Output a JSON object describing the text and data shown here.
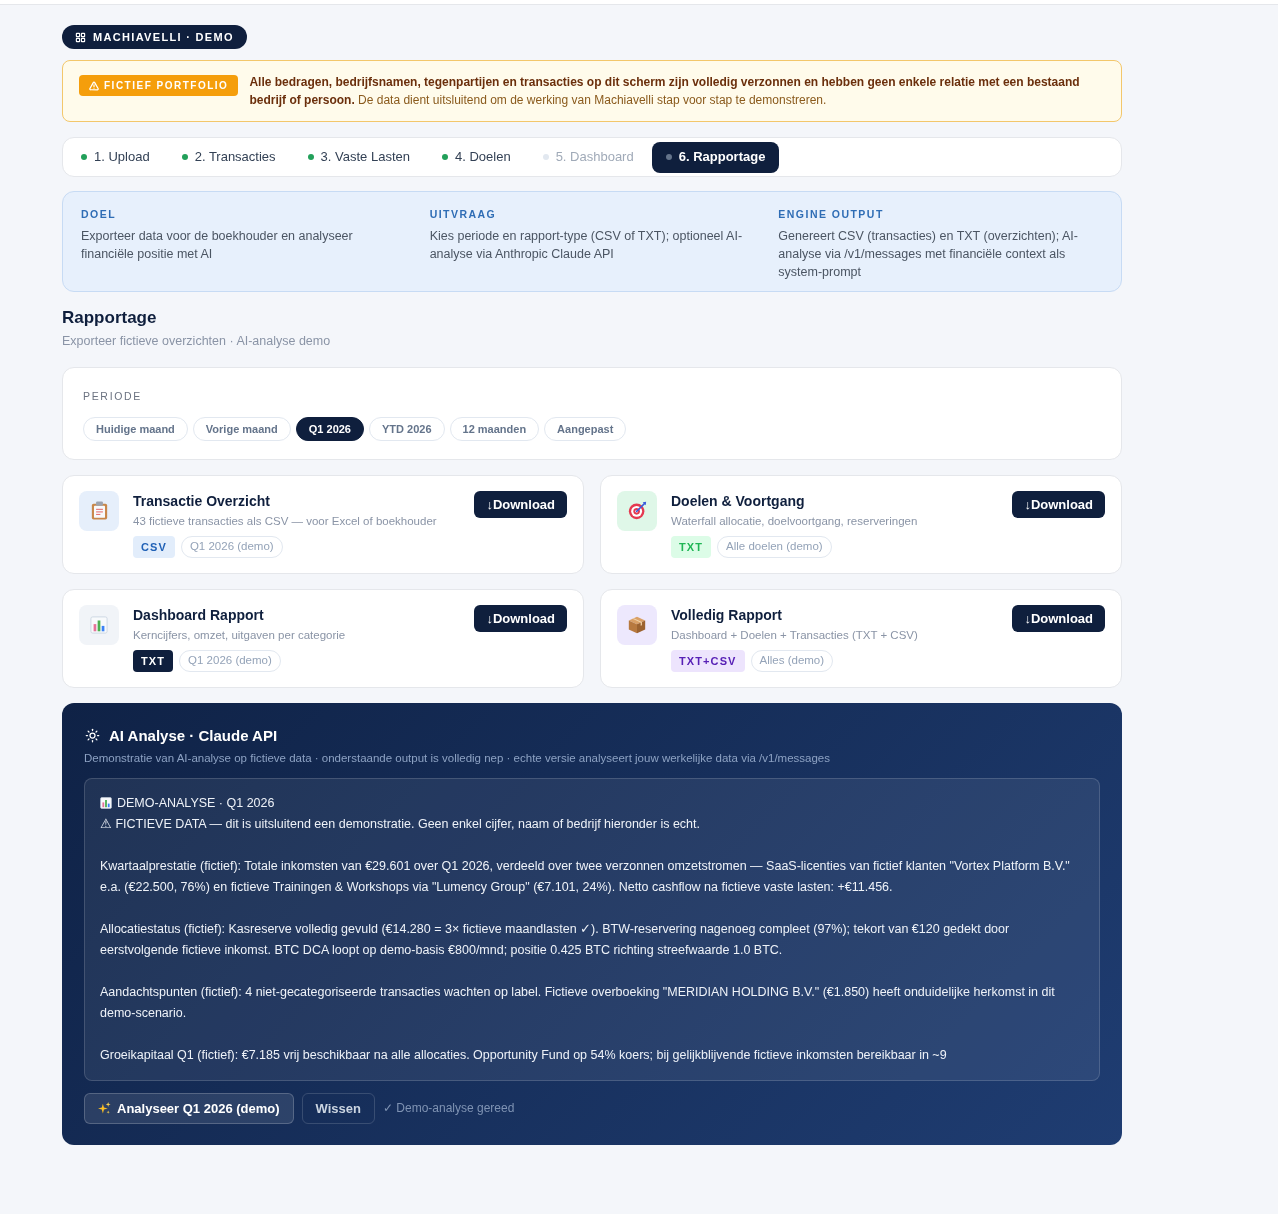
{
  "brand": {
    "label": "MACHIAVELLI · DEMO"
  },
  "notice": {
    "badge": "FICTIEF PORTFOLIO",
    "text": "**Alle bedragen, bedrijfsnamen, tegenpartijen en transacties op dit scherm zijn volledig verzonnen en hebben geen enkele relatie met een bestaand bedrijf of persoon.** De data dient uitsluitend om de werking van Machiavelli stap voor stap te demonstreren."
  },
  "steps": [
    {
      "label": "1. Upload",
      "done": true,
      "selected": false
    },
    {
      "label": "2. Transacties",
      "done": true,
      "selected": false
    },
    {
      "label": "3. Vaste Lasten",
      "done": true,
      "selected": false
    },
    {
      "label": "4. Doelen",
      "done": true,
      "selected": false
    },
    {
      "label": "5. Dashboard",
      "done": false,
      "selected": false
    },
    {
      "label": "6. Rapportage",
      "done": false,
      "selected": true
    }
  ],
  "info": [
    {
      "heading": "DOEL",
      "text": "Exporteer data voor de boekhouder en analyseer financiële positie met AI"
    },
    {
      "heading": "UITVRAAG",
      "text": "Kies periode en rapport-type (CSV of TXT); optioneel AI-analyse via Anthropic Claude API"
    },
    {
      "heading": "ENGINE OUTPUT",
      "text": "Genereert CSV (transacties) en TXT (overzichten); AI-analyse via /v1/messages met financiële context als system-prompt"
    }
  ],
  "header": {
    "title": "Rapportage",
    "subtitle": "Exporteer fictieve overzichten · AI-analyse demo"
  },
  "period": {
    "label": "PERIODE",
    "options": [
      {
        "label": "Huidige maand",
        "selected": false
      },
      {
        "label": "Vorige maand",
        "selected": false
      },
      {
        "label": "Q1 2026",
        "selected": true
      },
      {
        "label": "YTD 2026",
        "selected": false
      },
      {
        "label": "12 maanden",
        "selected": false
      },
      {
        "label": "Aangepast",
        "selected": false
      }
    ]
  },
  "reports": [
    {
      "title": "Transactie Overzicht",
      "description": "43 fictieve transacties als CSV — voor Excel of boekhouder",
      "icon": {
        "color": "#e6effb"
      },
      "format": {
        "label": "CSV",
        "color": "#e2edfb"
      },
      "scope": "Q1 2026 (demo)",
      "download": "↓Download"
    },
    {
      "title": "Doelen & Voortgang",
      "description": "Waterfall allocatie, doelvoortgang, reserveringen",
      "icon": {
        "color": "#dff7e8"
      },
      "format": {
        "label": "TXT",
        "color": "#dcfce7"
      },
      "scope": "Alle doelen (demo)",
      "download": "↓Download"
    },
    {
      "title": "Dashboard Rapport",
      "description": "Kerncijfers, omzet, uitgaven per categorie",
      "icon": {
        "color": "#f1f4f8"
      },
      "format": {
        "label": "TXT",
        "color": "#0f1f3d"
      },
      "scope": "Q1 2026 (demo)",
      "download": "↓Download"
    },
    {
      "title": "Volledig Rapport",
      "description": "Dashboard + Doelen + Transacties (TXT + CSV)",
      "icon": {
        "color": "#ede8fd"
      },
      "format": {
        "label": "TXT+CSV",
        "color": "#ede4fd"
      },
      "scope": "Alles (demo)",
      "download": "↓Download"
    }
  ],
  "ai": {
    "title": "AI Analyse · Claude API",
    "subtitle": "Demonstratie van AI-analyse op fictieve data · onderstaande output is volledig nep · echte versie analyseert jouw werkelijke data via /v1/messages",
    "output": {
      "heading": "DEMO-ANALYSE · Q1 2026",
      "warning": "⚠ FICTIEVE DATA — dit is uitsluitend een demonstratie. Geen enkel cijfer, naam of bedrijf hieronder is echt.",
      "paragraphs": [
        "Kwartaalprestatie (fictief): Totale inkomsten van €29.601 over Q1 2026, verdeeld over twee verzonnen omzetstromen — SaaS-licenties van fictief klanten \"Vortex Platform B.V.\" e.a. (€22.500, 76%) en fictieve Trainingen & Workshops via \"Lumency Group\" (€7.101, 24%). Netto cashflow na fictieve vaste lasten: +€11.456.",
        "Allocatiestatus (fictief): Kasreserve volledig gevuld (€14.280 = 3× fictieve maandlasten ✓). BTW-reservering nagenoeg compleet (97%); tekort van €120 gedekt door eerstvolgende fictieve inkomst. BTC DCA loopt op demo-basis €800/mnd; positie 0.425 BTC richting streefwaarde 1.0 BTC.",
        "Aandachtspunten (fictief): 4 niet-gecategoriseerde transacties wachten op label. Fictieve overboeking \"MERIDIAN HOLDING B.V.\" (€1.850) heeft onduidelijke herkomst in dit demo-scenario.",
        "Groeikapitaal Q1 (fictief): €7.185 vrij beschikbaar na alle allocaties. Opportunity Fund op 54% koers; bij gelijkblijvende fictieve inkomsten bereikbaar in ~9"
      ]
    },
    "buttons": [
      {
        "label": "Analyseer Q1 2026 (demo)",
        "kind": "primary"
      },
      {
        "label": "Wissen",
        "kind": "secondary"
      }
    ],
    "status": "✓ Demo-analyse gereed"
  }
}
